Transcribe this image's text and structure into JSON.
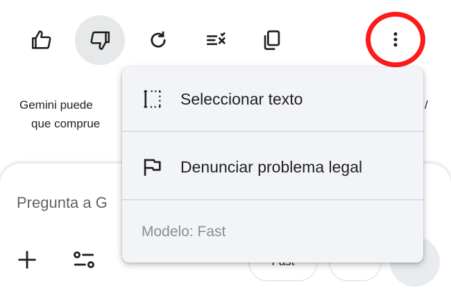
{
  "toolbar": {
    "buttons": [
      {
        "name": "thumbs-up-icon",
        "active": false
      },
      {
        "name": "thumbs-down-icon",
        "active": true
      },
      {
        "name": "regenerate-icon",
        "active": false
      },
      {
        "name": "modify-response-icon",
        "active": false
      },
      {
        "name": "copy-icon",
        "active": false
      },
      {
        "name": "more-vert-icon",
        "active": false,
        "highlight_color": "#ff1a1a"
      }
    ]
  },
  "disclaimer": {
    "line1_start": "Gemini puede",
    "line1_end": "/",
    "line2_start": "que comprue"
  },
  "composer": {
    "placeholder": "Pregunta a G",
    "mode_label": "Fast"
  },
  "menu": {
    "items": [
      {
        "icon": "select-text-icon",
        "label": "Seleccionar texto"
      },
      {
        "icon": "flag-icon",
        "label": "Denunciar problema legal"
      }
    ],
    "footer": "Modelo: Fast"
  }
}
